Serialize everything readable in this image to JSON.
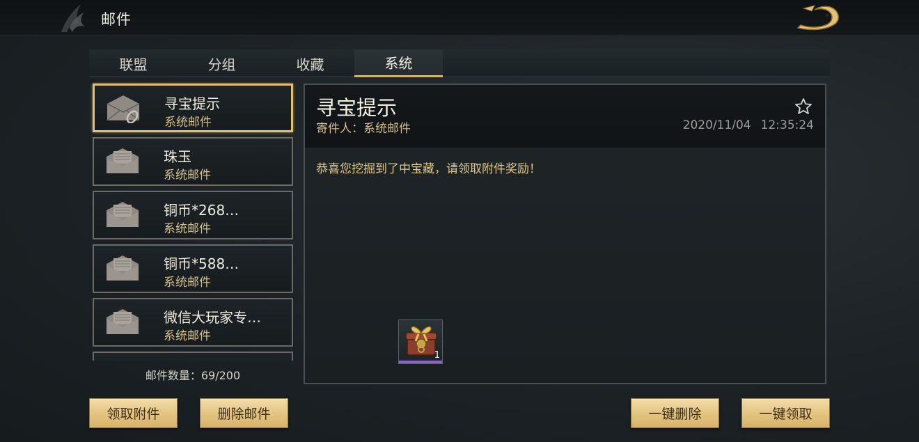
{
  "header": {
    "title": "邮件"
  },
  "tabs": [
    {
      "label": "联盟"
    },
    {
      "label": "分组"
    },
    {
      "label": "收藏"
    },
    {
      "label": "系统"
    }
  ],
  "active_tab": "系统",
  "mail_list": [
    {
      "title": "寻宝提示",
      "subtitle": "系统邮件",
      "has_attachment": true,
      "selected": true
    },
    {
      "title": "珠玉",
      "subtitle": "系统邮件",
      "has_attachment": false,
      "selected": false
    },
    {
      "title": "铜币*268…",
      "subtitle": "系统邮件",
      "has_attachment": false,
      "selected": false
    },
    {
      "title": "铜币*588…",
      "subtitle": "系统邮件",
      "has_attachment": false,
      "selected": false
    },
    {
      "title": "微信大玩家专…",
      "subtitle": "系统邮件",
      "has_attachment": false,
      "selected": false
    }
  ],
  "mail_count": "邮件数量：69/200",
  "detail": {
    "title": "寻宝提示",
    "sender": "寄件人：系统邮件",
    "date": "2020/11/04",
    "time": "12:35:24",
    "body": "恭喜您挖掘到了中宝藏，请领取附件奖励！",
    "attachment": {
      "icon": "treasure-chest-icon",
      "count": "1",
      "rarity_color": "#8a63c7"
    }
  },
  "buttons": {
    "claim_attachment": "领取附件",
    "delete_mail": "删除邮件",
    "delete_all": "一键删除",
    "claim_all": "一键领取"
  },
  "colors": {
    "accent_gold": "#e1c074",
    "subtitle_gold": "#d6c08d",
    "button_gold": "#e4c582"
  }
}
